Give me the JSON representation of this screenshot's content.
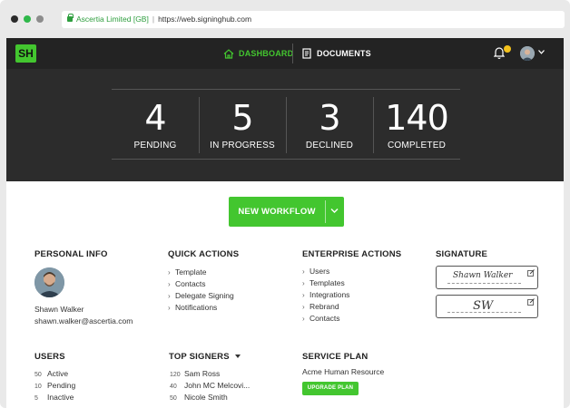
{
  "browser": {
    "site_name": "Ascertia Limited [GB]",
    "url": "https://web.signinghub.com"
  },
  "header": {
    "logo": "SH",
    "nav": [
      {
        "label": "DASHBOARD",
        "icon": "home-icon",
        "active": true
      },
      {
        "label": "DOCUMENTS",
        "icon": "documents-icon",
        "active": false
      }
    ],
    "notification_icon": "bell-icon"
  },
  "stats": [
    {
      "value": "4",
      "label": "PENDING"
    },
    {
      "value": "5",
      "label": "IN PROGRESS"
    },
    {
      "value": "3",
      "label": "DECLINED"
    },
    {
      "value": "140",
      "label": "COMPLETED"
    }
  ],
  "new_workflow": {
    "label": "NEW WORKFLOW"
  },
  "personal_info": {
    "title": "PERSONAL INFO",
    "name": "Shawn Walker",
    "email": "shawn.walker@ascertia.com"
  },
  "quick_actions": {
    "title": "QUICK ACTIONS",
    "items": [
      "Template",
      "Contacts",
      "Delegate Signing",
      "Notifications"
    ]
  },
  "enterprise_actions": {
    "title": "ENTERPRISE ACTIONS",
    "items": [
      "Users",
      "Templates",
      "Integrations",
      "Rebrand",
      "Contacts"
    ]
  },
  "signature": {
    "title": "SIGNATURE",
    "signature_text": "Shawn Walker",
    "initials_text": "SW"
  },
  "users": {
    "title": "USERS",
    "items": [
      {
        "count": "50",
        "label": "Active"
      },
      {
        "count": "10",
        "label": "Pending"
      },
      {
        "count": "5",
        "label": "Inactive"
      }
    ]
  },
  "top_signers": {
    "title": "TOP SIGNERS",
    "items": [
      {
        "count": "120",
        "label": "Sam Ross"
      },
      {
        "count": "40",
        "label": "John MC Melcovi..."
      },
      {
        "count": "50",
        "label": "Nicole Smith"
      }
    ]
  },
  "service_plan": {
    "title": "SERVICE PLAN",
    "plan": "Acme Human Resource",
    "upgrade_label": "UPGRADE PLAN"
  },
  "colors": {
    "accent": "#43c62f",
    "header_bg": "#232323",
    "stats_bg": "#2c2c2c",
    "badge": "#f4c21c"
  }
}
